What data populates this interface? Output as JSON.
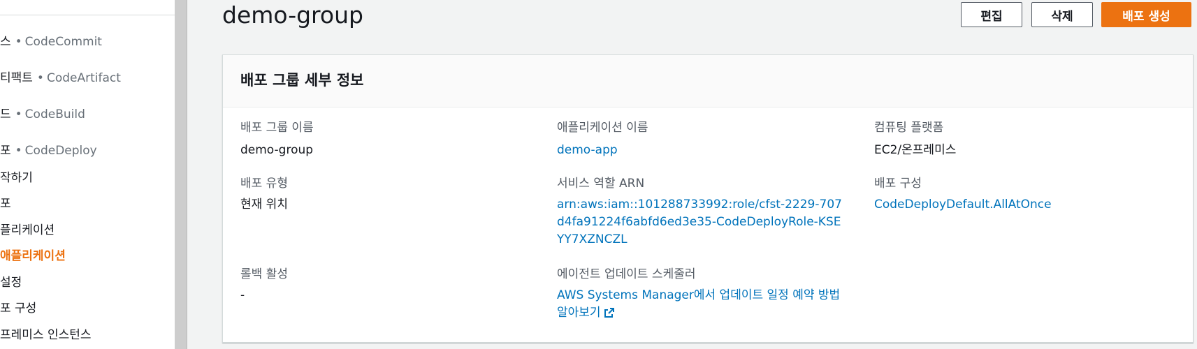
{
  "sidebar": {
    "items": [
      {
        "label": "스",
        "service": "CodeCommit"
      },
      {
        "label": "티팩트",
        "service": "CodeArtifact"
      },
      {
        "label": "드",
        "service": "CodeBuild"
      },
      {
        "label": "포",
        "service": "CodeDeploy"
      },
      {
        "label": "작하기"
      },
      {
        "label": "포"
      },
      {
        "label": "플리케이션"
      },
      {
        "label": " 애플리케이션",
        "active": true
      },
      {
        "label": " 설정"
      },
      {
        "label": "포 구성"
      },
      {
        "label": "프레미스 인스턴스"
      }
    ]
  },
  "header": {
    "title": "demo-group",
    "edit_label": "편집",
    "delete_label": "삭제",
    "create_label": "배포 생성"
  },
  "details": {
    "section_title": "배포 그룹 세부 정보",
    "group_name": {
      "label": "배포 그룹 이름",
      "value": "demo-group"
    },
    "app_name": {
      "label": "애플리케이션 이름",
      "value": "demo-app"
    },
    "platform": {
      "label": "컴퓨팅 플랫폼",
      "value": "EC2/온프레미스"
    },
    "deploy_type": {
      "label": "배포 유형",
      "value": "현재 위치"
    },
    "role_arn": {
      "label": "서비스 역할 ARN",
      "value": "arn:aws:iam::101288733992:role/cfst-2229-707d4fa91224f6abfd6ed3e35-CodeDeployRole-KSEYY7XZNCZL"
    },
    "deploy_config": {
      "label": "배포 구성",
      "value": "CodeDeployDefault.AllAtOnce"
    },
    "rollback": {
      "label": "롤백 활성",
      "value": "-"
    },
    "agent_scheduler": {
      "label": "에이전트 업데이트 스케줄러",
      "link_text": "AWS Systems Manager",
      "link_suffix": "에서 업데이트 일정 예약 방법 알아보기"
    }
  },
  "colors": {
    "accent": "#ec7211",
    "link": "#0073bb",
    "text": "#16191f",
    "muted": "#545b64"
  },
  "icons": {
    "external_link": "external-link-icon"
  }
}
